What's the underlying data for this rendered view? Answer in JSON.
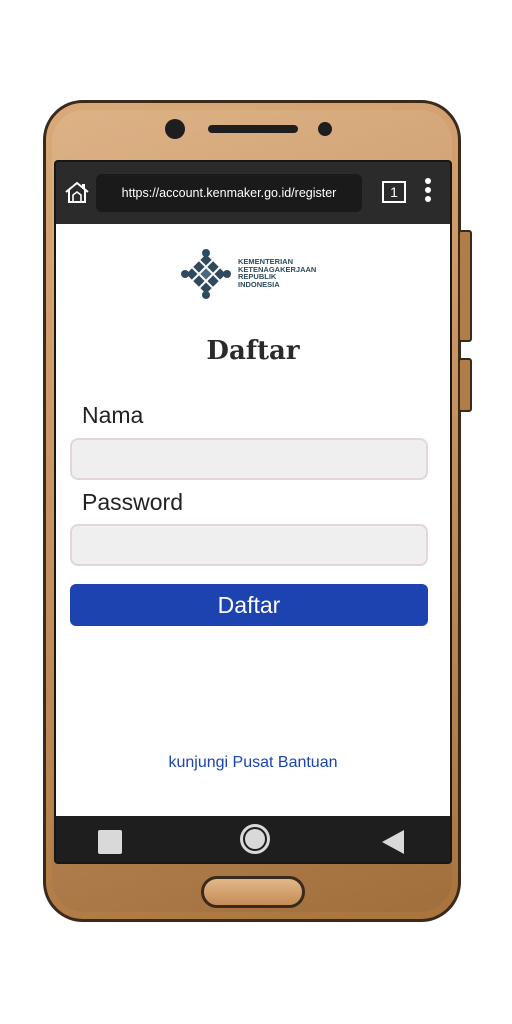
{
  "browser": {
    "url": "https://account.kenmaker.go.id/register",
    "tab_count": "1"
  },
  "logo": {
    "line1": "KEMENTERIAN",
    "line2": "KETENAGAKERJAAN",
    "line3": "REPUBLIK",
    "line4": "INDONESIA"
  },
  "form": {
    "title": "Daftar",
    "name_label": "Nama",
    "name_value": "",
    "password_label": "Password",
    "password_value": "",
    "submit_label": "Daftar"
  },
  "footer": {
    "help_link": "kunjungi Pusat Bantuan"
  },
  "colors": {
    "primary": "#1d43b0",
    "phone_body": "#c89260"
  }
}
